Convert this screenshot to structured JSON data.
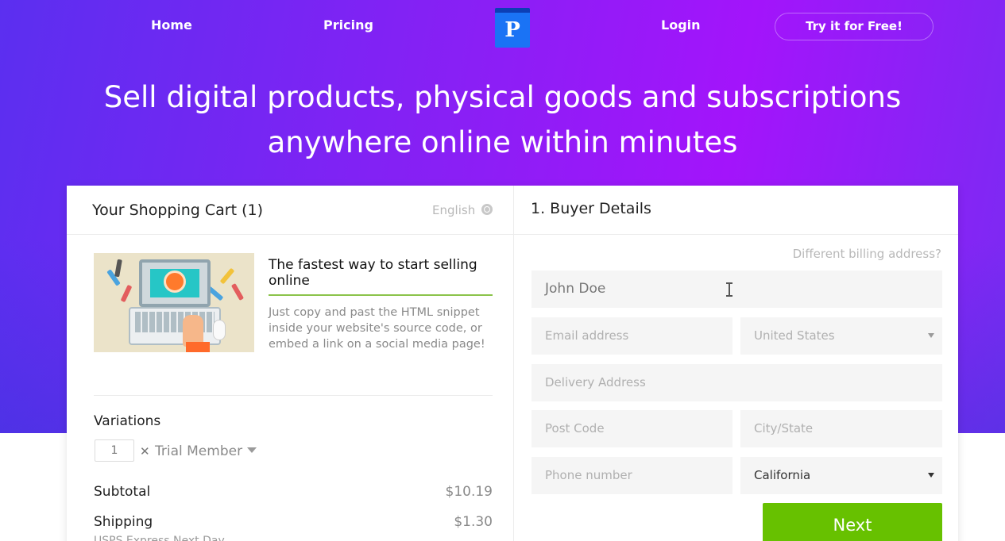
{
  "nav": {
    "home": "Home",
    "pricing": "Pricing",
    "logo_letter": "P",
    "login": "Login",
    "cta": "Try it for Free!"
  },
  "hero": {
    "line1": "Sell digital products, physical goods and subscriptions",
    "line2": "anywhere online within minutes"
  },
  "cart": {
    "title": "Your Shopping Cart (1)",
    "language": "English",
    "product": {
      "name": "The fastest way to start selling online",
      "description": "Just copy and past the HTML snippet inside your website's source code, or embed a link on a social media page!"
    },
    "variations_label": "Variations",
    "quantity": "1",
    "remove_symbol": "✕",
    "variant": "Trial Member",
    "subtotal_label": "Subtotal",
    "subtotal_value": "$10.19",
    "shipping_label": "Shipping",
    "shipping_value": "$1.30",
    "shipping_method": "USPS Express Next Day"
  },
  "buyer": {
    "title": "1. Buyer Details",
    "billing_link": "Different billing address?",
    "name_value": "John Doe",
    "email_placeholder": "Email address",
    "country": "United States",
    "address_placeholder": "Delivery Address",
    "postcode_placeholder": "Post Code",
    "city_placeholder": "City/State",
    "phone_placeholder": "Phone number",
    "state": "California",
    "next_label": "Next"
  },
  "colors": {
    "accent_purple": "#a314fb",
    "logo_blue": "#1a73f5",
    "next_green": "#67c100",
    "product_underline": "#8bc34a"
  }
}
